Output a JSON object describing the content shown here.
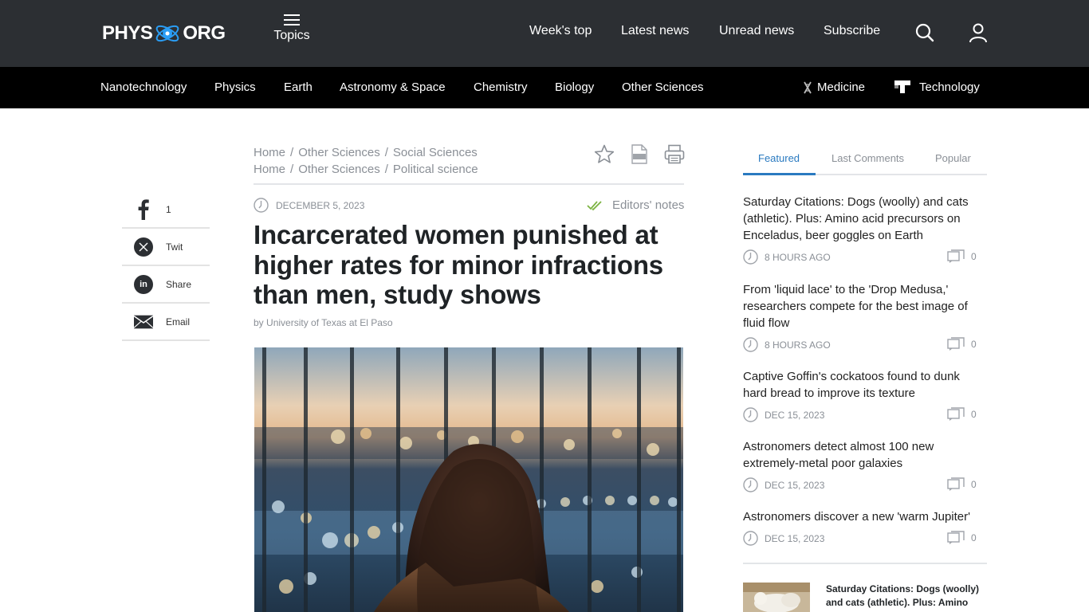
{
  "header": {
    "logo_left": "PHYS",
    "logo_right": "ORG",
    "topics_label": "Topics",
    "nav": [
      "Week's top",
      "Latest news",
      "Unread news",
      "Subscribe"
    ]
  },
  "subnav": {
    "items": [
      "Nanotechnology",
      "Physics",
      "Earth",
      "Astronomy & Space",
      "Chemistry",
      "Biology",
      "Other Sciences"
    ],
    "medicine": "Medicine",
    "technology": "Technology"
  },
  "share": {
    "facebook_count": "1",
    "twitter": "Twit",
    "linkedin": "Share",
    "email": "Email"
  },
  "breadcrumbs": [
    [
      "Home",
      "Other Sciences",
      "Social Sciences"
    ],
    [
      "Home",
      "Other Sciences",
      "Political science"
    ]
  ],
  "article": {
    "date": "DECEMBER 5, 2023",
    "editors_notes": "Editors' notes",
    "title": "Incarcerated women punished at higher rates for minor infractions than men, study shows",
    "by": "by",
    "source": "University of Texas at El Paso"
  },
  "sidebar": {
    "tabs": [
      "Featured",
      "Last Comments",
      "Popular"
    ],
    "featured": [
      {
        "title": "Saturday Citations: Dogs (woolly) and cats (athletic). Plus: Amino acid precursors on Enceladus, beer goggles on Earth",
        "time": "8 HOURS AGO",
        "comments": "0"
      },
      {
        "title": "From 'liquid lace' to the 'Drop Medusa,' researchers compete for the best image of fluid flow",
        "time": "8 HOURS AGO",
        "comments": "0"
      },
      {
        "title": "Captive Goffin's cockatoos found to dunk hard bread to improve its texture",
        "time": "DEC 15, 2023",
        "comments": "0"
      },
      {
        "title": "Astronomers detect almost 100 new extremely-metal poor galaxies",
        "time": "DEC 15, 2023",
        "comments": "0"
      },
      {
        "title": "Astronomers discover a new 'warm Jupiter'",
        "time": "DEC 15, 2023",
        "comments": "0"
      }
    ],
    "bottom_title": "Saturday Citations: Dogs (woolly) and cats (athletic). Plus: Amino"
  },
  "colors": {
    "header_bg": "#2c2f33",
    "subnav_bg": "#000000",
    "accent": "#2a7ac0",
    "muted": "#8a8f96",
    "check_green": "#7cb342"
  }
}
